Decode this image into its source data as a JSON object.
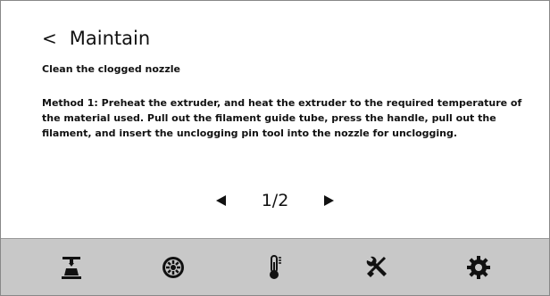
{
  "header": {
    "back_glyph": "<",
    "title": "Maintain"
  },
  "content": {
    "subtitle": "Clean the clogged nozzle",
    "method": "Method 1: Preheat the extruder, and heat the extruder to the required temperature of the material used. Pull out the filament guide tube, press the handle, pull out the filament, and insert the unclogging pin tool into the nozzle for unclogging."
  },
  "pager": {
    "page_label": "1/2",
    "prev_icon": "triangle-left-icon",
    "next_icon": "triangle-right-icon"
  },
  "navbar": {
    "items": [
      {
        "icon": "print-icon"
      },
      {
        "icon": "filament-spool-icon"
      },
      {
        "icon": "thermometer-icon"
      },
      {
        "icon": "tools-icon"
      },
      {
        "icon": "gear-icon"
      }
    ]
  },
  "colors": {
    "background": "#ffffff",
    "navbar": "#c8c8c8",
    "text": "#111111"
  }
}
